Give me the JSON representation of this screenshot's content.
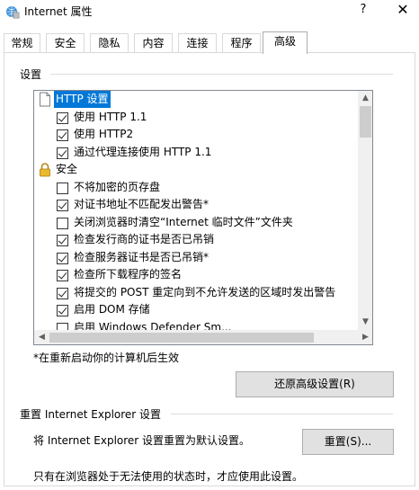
{
  "window": {
    "title": "Internet 属性",
    "help_label": "?",
    "close_label": "✕",
    "app_icon": "internet-options-icon"
  },
  "tabs": [
    {
      "label": "常规"
    },
    {
      "label": "安全"
    },
    {
      "label": "隐私"
    },
    {
      "label": "内容"
    },
    {
      "label": "连接"
    },
    {
      "label": "程序"
    },
    {
      "label": "高级",
      "active": true
    }
  ],
  "settings": {
    "label": "设置",
    "rows": [
      {
        "type": "group",
        "icon": "page-icon",
        "label": "HTTP 设置",
        "selected": true
      },
      {
        "type": "item",
        "checked": true,
        "label": "使用 HTTP 1.1"
      },
      {
        "type": "item",
        "checked": true,
        "label": "使用 HTTP2"
      },
      {
        "type": "item",
        "checked": true,
        "label": "通过代理连接使用 HTTP 1.1"
      },
      {
        "type": "group",
        "icon": "lock-icon",
        "label": "安全"
      },
      {
        "type": "item",
        "checked": false,
        "label": "不将加密的页存盘"
      },
      {
        "type": "item",
        "checked": true,
        "label": "对证书地址不匹配发出警告*"
      },
      {
        "type": "item",
        "checked": false,
        "label": "关闭浏览器时清空“Internet 临时文件”文件夹"
      },
      {
        "type": "item",
        "checked": true,
        "label": "检查发行商的证书是否已吊销"
      },
      {
        "type": "item",
        "checked": true,
        "label": "检查服务器证书是否已吊销*"
      },
      {
        "type": "item",
        "checked": true,
        "label": "检查所下载程序的签名"
      },
      {
        "type": "item",
        "checked": true,
        "label": "将提交的 POST 重定向到不允许发送的区域时发出警告"
      },
      {
        "type": "item",
        "checked": true,
        "label": "启用 DOM 存储"
      },
      {
        "type": "item",
        "checked": false,
        "label": "启用 Windows Defender Sm..."
      }
    ],
    "note": "*在重新启动你的计算机后生效",
    "restore_button": "还原高级设置(R)"
  },
  "reset": {
    "label": "重置 Internet Explorer 设置",
    "description": "将 Internet Explorer 设置重置为默认设置。",
    "button": "重置(S)...",
    "footer": "只有在浏览器处于无法使用的状态时，才应使用此设置。"
  },
  "colors": {
    "selection": "#0078d7",
    "button_bg": "#e1e1e1",
    "scrollbar": "#f0f0f0"
  }
}
